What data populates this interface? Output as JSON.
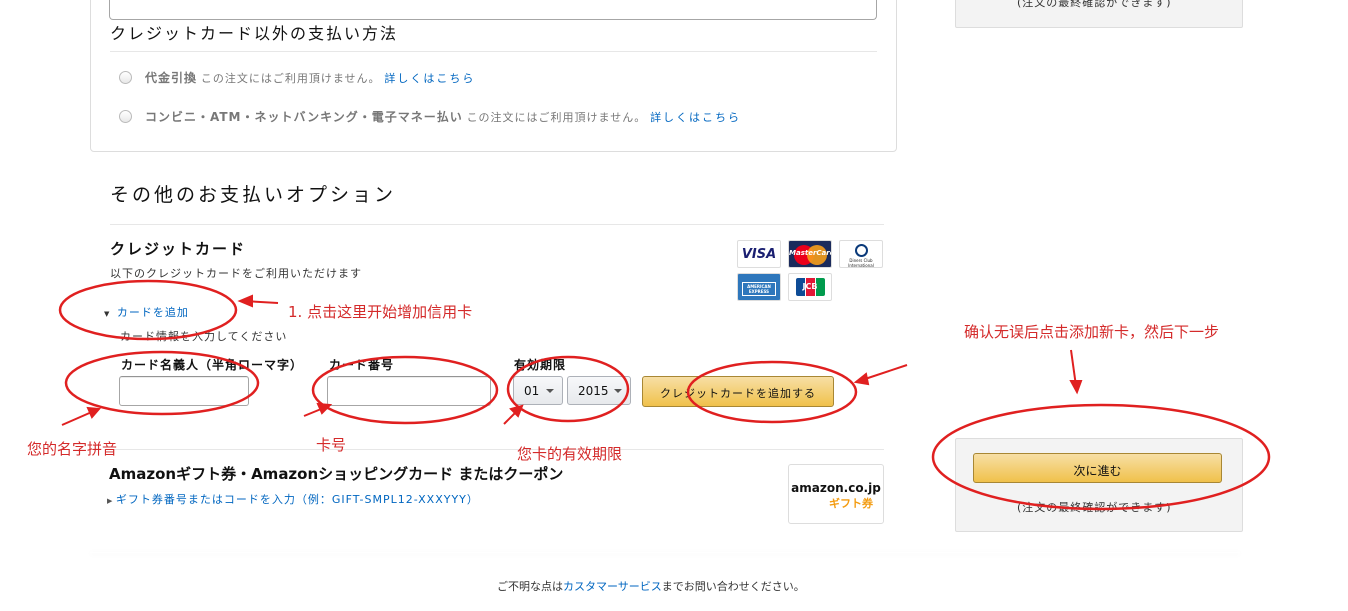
{
  "other_methods": {
    "heading": "クレジットカード以外の支払い方法",
    "cod": {
      "label": "代金引換",
      "note": "この注文にはご利用頂けません。",
      "link": "詳しくはこちら"
    },
    "konbini": {
      "label": "コンビニ・ATM・ネットバンキング・電子マネー払い",
      "note": "この注文にはご利用頂けません。",
      "link": "詳しくはこちら"
    }
  },
  "options": {
    "heading": "その他のお支払いオプション",
    "credit": {
      "title": "クレジットカード",
      "subtitle": "以下のクレジットカードをご利用いただけます",
      "add_card_link": "カードを追加",
      "instructions": "カード情報を入力してください",
      "name_label": "カード名義人（半角ローマ字）",
      "number_label": "カード番号",
      "expiry_label": "有効期限",
      "month_value": "01",
      "year_value": "2015",
      "add_button": "クレジットカードを追加する",
      "logos": {
        "visa": "VISA",
        "mastercard": "MasterCard",
        "diners": "Diners Club International",
        "amex": "AMERICAN EXPRESS",
        "jcb": "JCB"
      }
    },
    "gift": {
      "title": "Amazonギフト券・Amazonショッピングカード またはクーポン",
      "link": "ギフト券番号またはコードを入力（例：GIFT-SMPL12-XXXYYY）",
      "logo_text": "amazon.co.jp",
      "logo_sub": "ギフト券"
    }
  },
  "sidebar": {
    "top_note": "(注文の最終確認ができます)",
    "next_button": "次に進む",
    "bottom_note": "(注文の最終確認ができます)"
  },
  "footer": {
    "text_prefix": "ご不明な点は",
    "link": "カスタマーサービス",
    "text_suffix": "までお問い合わせください。"
  },
  "annotations": {
    "step1": "1. 点击这里开始增加信用卡",
    "confirm": "确认无误后点击添加新卡，然后下一步",
    "name": "您的名字拼音",
    "number": "卡号",
    "expiry": "您卡的有效期限"
  },
  "colors": {
    "link": "#0066c0",
    "annotation": "#e02020",
    "button_yellow": "#f0c14b"
  }
}
